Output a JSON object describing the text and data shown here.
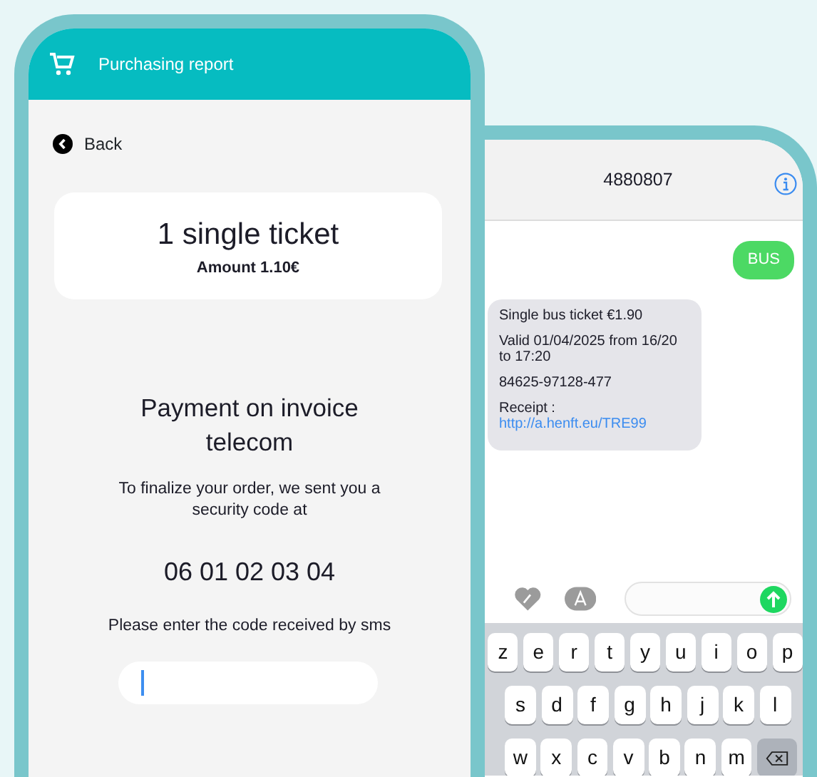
{
  "left_phone": {
    "header": {
      "title": "Purchasing report"
    },
    "back": {
      "label": "Back"
    },
    "ticket_card": {
      "title": "1 single ticket",
      "amount": "Amount 1.10€"
    },
    "payment": {
      "title": "Payment on invoice telecom",
      "message": "To finalize your order, we sent you a security code at",
      "phone_number": "06 01 02 03 04",
      "prompt": "Please enter the code received by sms"
    },
    "code_field": {
      "focused": true
    }
  },
  "right_phone": {
    "contact": "4880807",
    "messages": [
      {
        "kind": "sent",
        "text": "BUS"
      },
      {
        "kind": "received",
        "lines": [
          {
            "text": "Single bus ticket €1.90"
          },
          {
            "text": "Valid 01/04/2025 from 16/20 to 17:20"
          },
          {
            "text": "84625-97128-477"
          },
          {
            "text": "Receipt :",
            "link": "http://a.henft.eu/TRE99"
          }
        ]
      }
    ],
    "keyboard": {
      "rows": [
        [
          "z",
          "e",
          "r",
          "t",
          "y",
          "u",
          "i",
          "o",
          "p"
        ],
        [
          "s",
          "d",
          "f",
          "g",
          "h",
          "j",
          "k",
          "l"
        ],
        [
          "w",
          "x",
          "c",
          "v",
          "b",
          "n",
          "m"
        ]
      ]
    }
  }
}
